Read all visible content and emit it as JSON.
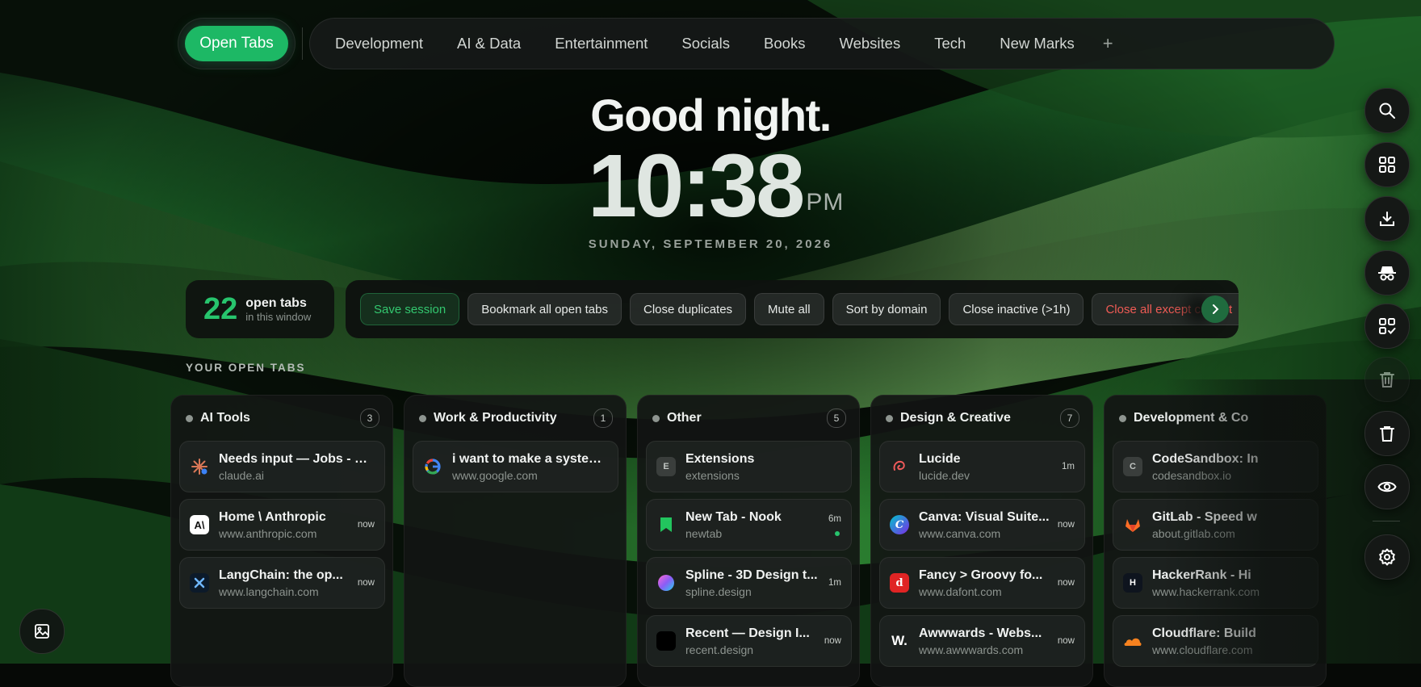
{
  "nav": {
    "active_tab": "Open Tabs",
    "items": [
      "Development",
      "AI & Data",
      "Entertainment",
      "Socials",
      "Books",
      "Websites",
      "Tech",
      "New Marks"
    ],
    "add_label": "+"
  },
  "hero": {
    "greeting": "Good night.",
    "time": "10:38",
    "ampm": "PM",
    "date": "SUNDAY, SEPTEMBER 20, 2026"
  },
  "tab_count": {
    "value": "22",
    "label": "open tabs",
    "sublabel": "in this window"
  },
  "actions": {
    "save": "Save session",
    "bookmark": "Bookmark all open tabs",
    "close_dupes": "Close duplicates",
    "mute": "Mute all",
    "sort": "Sort by domain",
    "close_inactive": "Close inactive (>1h)",
    "close_except": "Close all except current"
  },
  "section_label": "YOUR OPEN TABS",
  "columns": [
    {
      "title": "AI Tools",
      "count": "3",
      "tabs": [
        {
          "title": "Needs input — Jobs - Cl...",
          "url": "claude.ai",
          "time": "",
          "icon": "claude-icon"
        },
        {
          "title": "Home \\ Anthropic",
          "url": "www.anthropic.com",
          "time": "now",
          "icon": "anthropic-icon"
        },
        {
          "title": "LangChain: the op...",
          "url": "www.langchain.com",
          "time": "now",
          "icon": "langchain-icon"
        }
      ]
    },
    {
      "title": "Work & Productivity",
      "count": "1",
      "tabs": [
        {
          "title": "i want to make a system...",
          "url": "www.google.com",
          "time": "",
          "icon": "google-icon"
        }
      ]
    },
    {
      "title": "Other",
      "count": "5",
      "tabs": [
        {
          "title": "Extensions",
          "url": "extensions",
          "time": "",
          "icon": "extensions-icon"
        },
        {
          "title": "New Tab - Nook",
          "url": "newtab",
          "time": "6m",
          "icon": "bookmark-icon"
        },
        {
          "title": "Spline - 3D Design t...",
          "url": "spline.design",
          "time": "1m",
          "icon": "spline-icon"
        },
        {
          "title": "Recent — Design I...",
          "url": "recent.design",
          "time": "now",
          "icon": "recent-icon"
        }
      ]
    },
    {
      "title": "Design & Creative",
      "count": "7",
      "tabs": [
        {
          "title": "Lucide",
          "url": "lucide.dev",
          "time": "1m",
          "icon": "lucide-icon"
        },
        {
          "title": "Canva: Visual Suite...",
          "url": "www.canva.com",
          "time": "now",
          "icon": "canva-icon"
        },
        {
          "title": "Fancy > Groovy fo...",
          "url": "www.dafont.com",
          "time": "now",
          "icon": "dafont-icon"
        },
        {
          "title": "Awwwards - Webs...",
          "url": "www.awwwards.com",
          "time": "now",
          "icon": "awwwards-icon"
        }
      ]
    },
    {
      "title": "Development & Co",
      "count": "",
      "tabs": [
        {
          "title": "CodeSandbox: In",
          "url": "codesandbox.io",
          "time": "",
          "icon": "codesandbox-icon"
        },
        {
          "title": "GitLab - Speed w",
          "url": "about.gitlab.com",
          "time": "",
          "icon": "gitlab-icon"
        },
        {
          "title": "HackerRank - Hi",
          "url": "www.hackerrank.com",
          "time": "",
          "icon": "hackerrank-icon"
        },
        {
          "title": "Cloudflare: Build",
          "url": "www.cloudflare.com",
          "time": "",
          "icon": "cloudflare-icon"
        }
      ]
    }
  ],
  "rail_icons": [
    "search-icon",
    "grid-icon",
    "download-icon",
    "incognito-icon",
    "grid-check-icon",
    "trash-disabled-icon",
    "trash-icon",
    "eye-icon",
    "settings-icon"
  ],
  "colors": {
    "accent": "#1db865",
    "danger": "#ef5b55",
    "panel": "#141816"
  }
}
